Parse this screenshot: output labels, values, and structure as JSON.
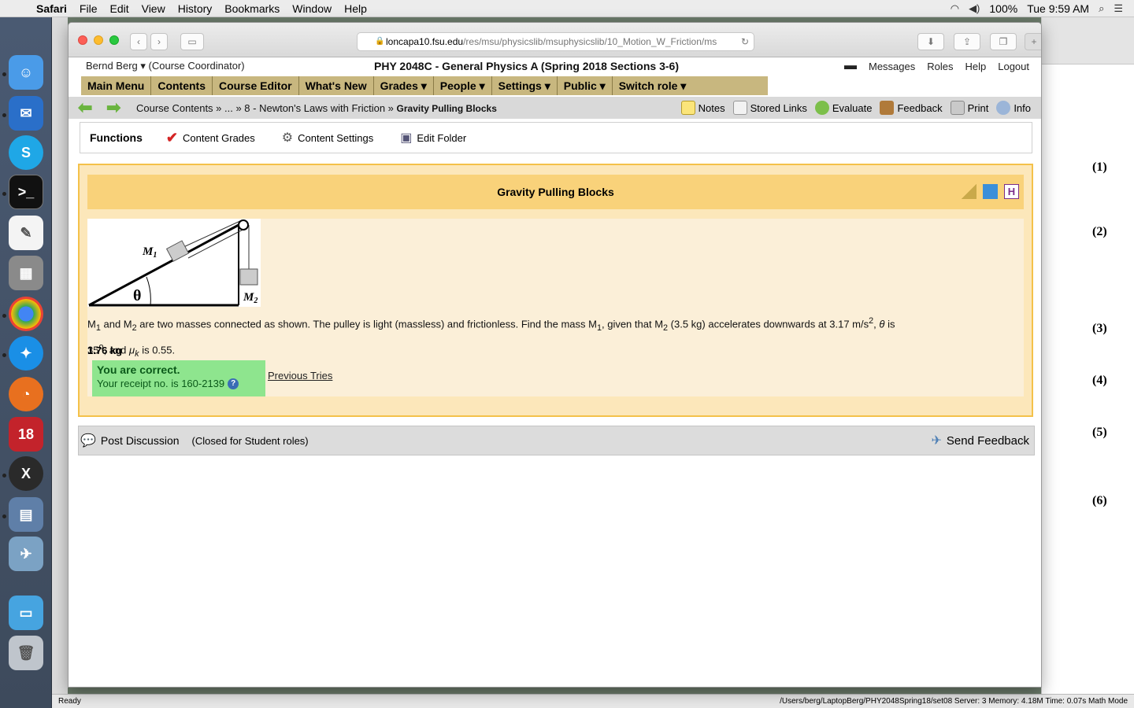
{
  "menubar": {
    "apple": "",
    "app": "Safari",
    "items": [
      "File",
      "Edit",
      "View",
      "History",
      "Bookmarks",
      "Window",
      "Help"
    ],
    "battery": "100%",
    "clock": "Tue 9:59 AM"
  },
  "safari": {
    "url_domain": "loncapa10.fsu.edu",
    "url_path": "/res/msu/physicslib/msuphysicslib/10_Motion_W_Friction/ms"
  },
  "header": {
    "user": "Bernd Berg ▾ (Course Coordinator)",
    "course": "PHY 2048C - General Physics A (Spring 2018 Sections 3-6)",
    "links": [
      "Messages",
      "Roles",
      "Help",
      "Logout"
    ]
  },
  "mainmenu": [
    "Main Menu",
    "Contents",
    "Course Editor",
    "What's New",
    "Grades ▾",
    "People ▾",
    "Settings ▾",
    "Public ▾",
    "Switch role ▾"
  ],
  "breadcrumb": {
    "prefix": "Course Contents » ... » 8 - Newton's Laws with Friction »",
    "current": "Gravity Pulling Blocks"
  },
  "tools": [
    "Notes",
    "Stored Links",
    "Evaluate",
    "Feedback",
    "Print",
    "Info"
  ],
  "functions": {
    "title": "Functions",
    "items": [
      "Content Grades",
      "Content Settings",
      "Edit Folder"
    ]
  },
  "problem": {
    "title": "Gravity Pulling Blocks",
    "figure": {
      "m1": "M",
      "m1_sub": "1",
      "m2": "M",
      "m2_sub": "2",
      "theta": "θ"
    },
    "text_a": "M",
    "sub1": "1",
    "text_b": " and M",
    "sub2": "2",
    "text_c": " are two masses connected as shown. The pulley is light (massless) and frictionless. Find the mass M",
    "sub3": "1",
    "text_d": ", given that M",
    "sub4": "2",
    "text_e": " (3.5 kg) accelerates downwards at 3.17 m/s",
    "sup1": "2",
    "text_f": ", ",
    "theta": "θ",
    "text_g": " is",
    "text_h": "35",
    "sup2": "o",
    "text_i": ", and ",
    "mu": "μ",
    "mu_sub": "k",
    "text_j": " is 0.55.",
    "answer": "1.76 kg",
    "correct": "You are correct.",
    "receipt": "Your receipt no. is 160-2139",
    "previous_tries": "Previous Tries"
  },
  "discussion": {
    "post": "Post Discussion",
    "closed": "(Closed for Student roles)",
    "send_feedback": "Send Feedback"
  },
  "background_numbers": [
    "(1)",
    "(2)",
    "(3)",
    "(4)",
    "(5)",
    "(6)"
  ],
  "statusbar": {
    "left": "Ready",
    "right": "/Users/berg/LaptopBerg/PHY2048Spring18/set08   Server: 3   Memory: 4.18M   Time: 0.07s   Math Mode"
  }
}
